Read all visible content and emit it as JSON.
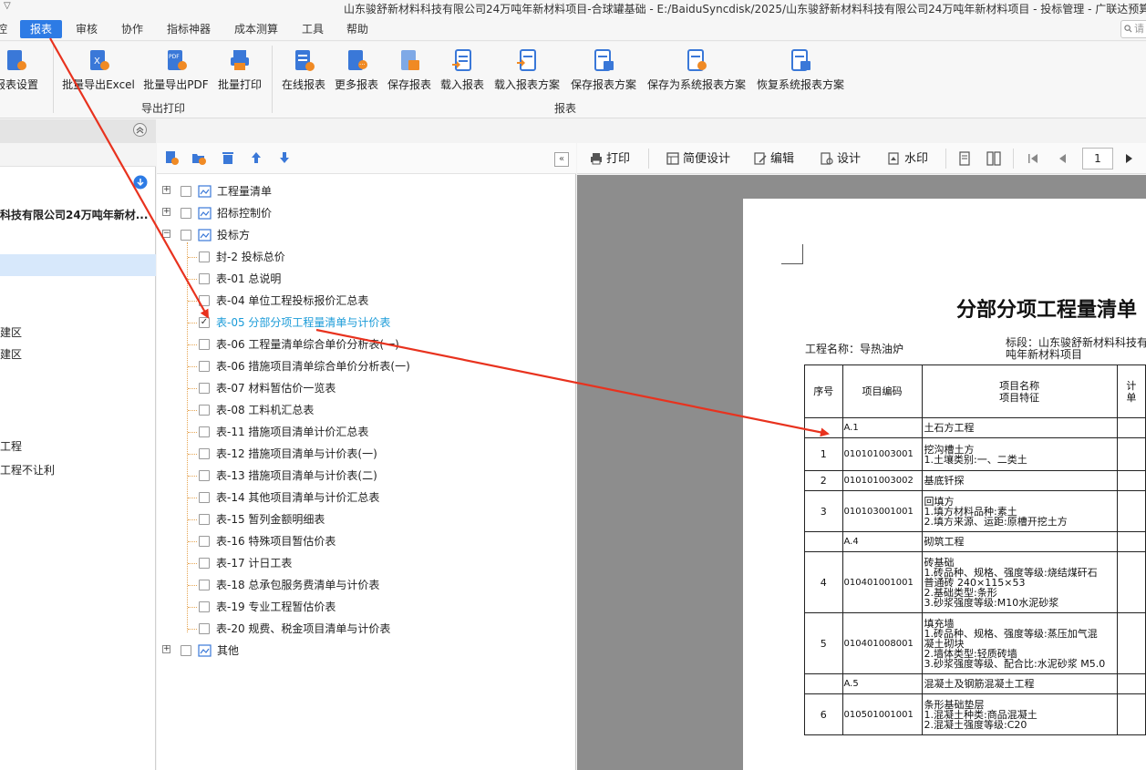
{
  "titlebar": {
    "quick_access": "▽",
    "title": "山东骏舒新材料科技有限公司24万吨年新材料项目-合球罐基础 - E:/BaiduSyncdisk/2025/山东骏舒新材料科技有限公司24万吨年新材料项目 - 投标管理 - 广联达预算"
  },
  "menu": {
    "items": [
      "控",
      "报表",
      "审核",
      "协作",
      "指标神器",
      "成本测算",
      "工具",
      "帮助"
    ],
    "active_index": 1,
    "search_placeholder": "请"
  },
  "ribbon": {
    "buttons": [
      {
        "label": "报表设置",
        "icon": "report-settings-icon"
      },
      {
        "label": "批量导出Excel",
        "icon": "excel-export-icon"
      },
      {
        "label": "批量导出PDF",
        "icon": "pdf-export-icon"
      },
      {
        "label": "批量打印",
        "icon": "batch-print-icon"
      },
      {
        "label": "在线报表",
        "icon": "online-report-icon"
      },
      {
        "label": "更多报表",
        "icon": "more-reports-icon"
      },
      {
        "label": "保存报表",
        "icon": "save-report-icon"
      },
      {
        "label": "载入报表",
        "icon": "load-report-icon"
      },
      {
        "label": "载入报表方案",
        "icon": "load-scheme-icon"
      },
      {
        "label": "保存报表方案",
        "icon": "save-scheme-icon"
      },
      {
        "label": "保存为系统报表方案",
        "icon": "save-system-scheme-icon"
      },
      {
        "label": "恢复系统报表方案",
        "icon": "restore-system-scheme-icon"
      }
    ],
    "groups": [
      "导出打印",
      "报表"
    ]
  },
  "left_panel": {
    "rows": [
      {
        "text": "科技有限公司24万吨年新材..."
      },
      {
        "text": ""
      },
      {
        "text": "建区"
      },
      {
        "text": "建区"
      },
      {
        "text": "工程"
      },
      {
        "text": "工程不让利"
      }
    ]
  },
  "tree": {
    "nodes": [
      {
        "label": "工程量清单",
        "checked": false
      },
      {
        "label": "招标控制价",
        "checked": false
      },
      {
        "label": "投标方",
        "checked": false
      },
      {
        "label": "封-2 投标总价",
        "checked": false
      },
      {
        "label": "表-01 总说明",
        "checked": false
      },
      {
        "label": "表-04 单位工程投标报价汇总表",
        "checked": false
      },
      {
        "label": "表-05 分部分项工程量清单与计价表",
        "checked": true
      },
      {
        "label": "表-06 工程量清单综合单价分析表(一)",
        "checked": false
      },
      {
        "label": "表-06 措施项目清单综合单价分析表(一)",
        "checked": false
      },
      {
        "label": "表-07 材料暂估价一览表",
        "checked": false
      },
      {
        "label": "表-08 工料机汇总表",
        "checked": false
      },
      {
        "label": "表-11 措施项目清单计价汇总表",
        "checked": false
      },
      {
        "label": "表-12 措施项目清单与计价表(一)",
        "checked": false
      },
      {
        "label": "表-13 措施项目清单与计价表(二)",
        "checked": false
      },
      {
        "label": "表-14 其他项目清单与计价汇总表",
        "checked": false
      },
      {
        "label": "表-15 暂列金额明细表",
        "checked": false
      },
      {
        "label": "表-16 特殊项目暂估价表",
        "checked": false
      },
      {
        "label": "表-17 计日工表",
        "checked": false
      },
      {
        "label": "表-18 总承包服务费清单与计价表",
        "checked": false
      },
      {
        "label": "表-19 专业工程暂估价表",
        "checked": false
      },
      {
        "label": "表-20 规费、税金项目清单与计价表",
        "checked": false
      },
      {
        "label": "其他",
        "checked": false
      }
    ],
    "collapse_label": "«"
  },
  "preview_toolbar": {
    "print": "打印",
    "simple_design": "简便设计",
    "edit": "编辑",
    "design": "设计",
    "watermark": "水印",
    "page": "1"
  },
  "report": {
    "title": "分部分项工程量清单",
    "project_label": "工程名称：导热油炉",
    "section_label_1": "标段：山东骏舒新材料科技有",
    "section_label_2": "吨年新材料项目",
    "headers": {
      "seq": "序号",
      "code": "项目编码",
      "name_1": "项目名称",
      "name_2": "项目特征",
      "extra_1": "计",
      "extra_2": "单"
    },
    "rows": [
      {
        "seq": "",
        "code": "A.1",
        "lines": [
          "土石方工程"
        ]
      },
      {
        "seq": "1",
        "code": "010101003001",
        "lines": [
          "挖沟槽土方",
          "1.土壤类别:一、二类土"
        ]
      },
      {
        "seq": "2",
        "code": "010101003002",
        "lines": [
          "基底钎探"
        ]
      },
      {
        "seq": "3",
        "code": "010103001001",
        "lines": [
          "回填方",
          "1.填方材料品种:素土",
          "2.填方来源、运距:原槽开挖土方"
        ]
      },
      {
        "seq": "",
        "code": "A.4",
        "lines": [
          "砌筑工程"
        ]
      },
      {
        "seq": "4",
        "code": "010401001001",
        "lines": [
          "砖基础",
          "1.砖品种、规格、强度等级:烧结煤矸石",
          "普通砖 240×115×53",
          "2.基础类型:条形",
          "3.砂浆强度等级:M10水泥砂浆"
        ]
      },
      {
        "seq": "5",
        "code": "010401008001",
        "lines": [
          "填充墙",
          "1.砖品种、规格、强度等级:蒸压加气混",
          "凝土砌块",
          "2.墙体类型:轻质砖墙",
          "3.砂浆强度等级、配合比:水泥砂浆 M5.0"
        ]
      },
      {
        "seq": "",
        "code": "A.5",
        "lines": [
          "混凝土及钢筋混凝土工程"
        ]
      },
      {
        "seq": "6",
        "code": "010501001001",
        "lines": [
          "条形基础垫层",
          "1.混凝土种类:商品混凝土",
          "2.混凝土强度等级:C20"
        ]
      }
    ]
  },
  "colors": {
    "accent": "#2d7be5",
    "highlight_text": "#1a9bd8",
    "annotation_arrow": "#e8321e"
  }
}
